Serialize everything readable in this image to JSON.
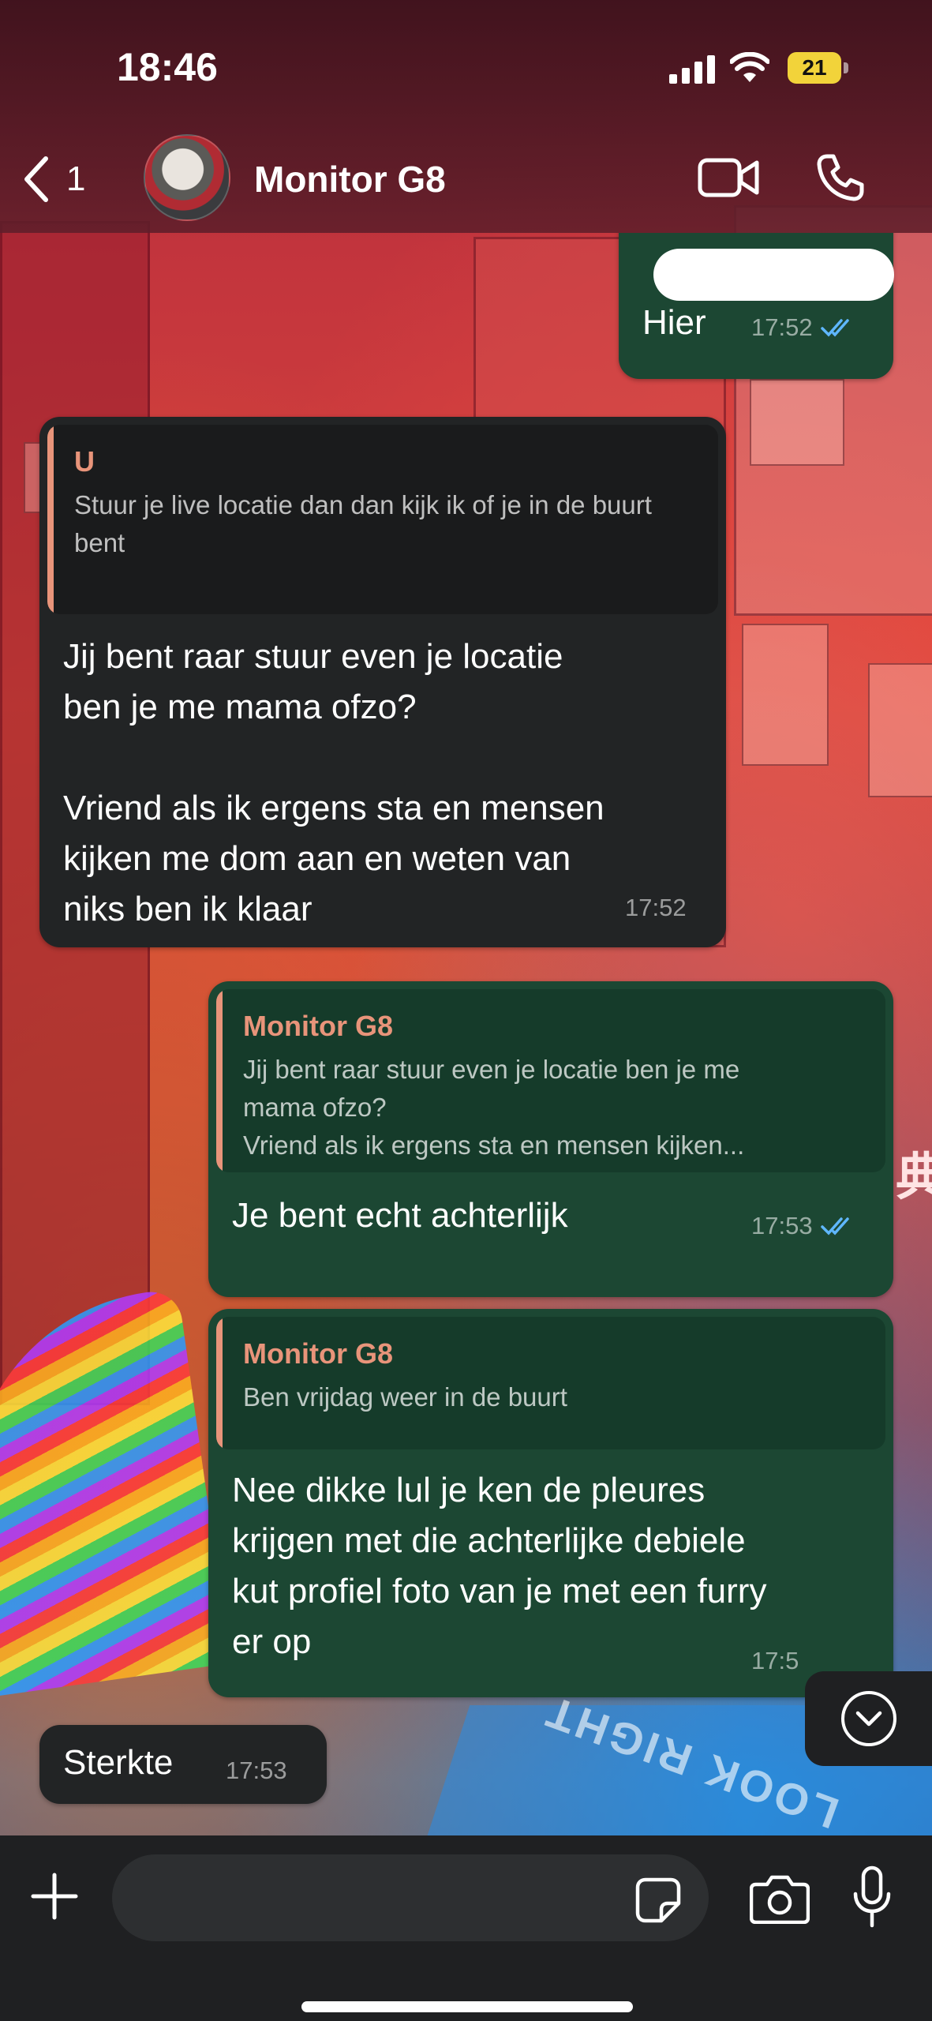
{
  "status_bar": {
    "time": "18:46",
    "battery": "21"
  },
  "header": {
    "back_count": "1",
    "contact_name": "Monitor G8"
  },
  "messages": [
    {
      "id": "m1",
      "direction": "out",
      "text": "Hier",
      "time": "17:52",
      "read": true
    },
    {
      "id": "m2",
      "direction": "in",
      "quote": {
        "author": "U",
        "text": "Stuur je live locatie dan dan kijk ik of je in de buurt bent"
      },
      "text_lines": [
        "Jij bent raar stuur even je locatie",
        "ben je me mama ofzo?",
        "",
        "Vriend als ik ergens sta en mensen",
        "kijken me dom aan en weten van",
        "niks ben ik klaar"
      ],
      "time": "17:52"
    },
    {
      "id": "m3",
      "direction": "out",
      "quote": {
        "author": "Monitor G8",
        "text_lines": [
          "Jij bent raar stuur even je locatie ben je me",
          "mama ofzo?",
          "Vriend als ik ergens sta en mensen kijken..."
        ]
      },
      "text": "Je bent echt achterlijk",
      "time": "17:53",
      "read": true
    },
    {
      "id": "m4",
      "direction": "out",
      "quote": {
        "author": "Monitor G8",
        "text": "Ben vrijdag weer in de buurt"
      },
      "text_lines": [
        "Nee dikke lul je ken de pleures",
        "krijgen met die achterlijke debiele",
        "kut profiel foto van je met een furry",
        "er op"
      ],
      "time_partial": "17:5"
    },
    {
      "id": "m5",
      "direction": "in",
      "text": "Sterkte",
      "time": "17:53"
    }
  ],
  "background": {
    "road_text": "LOOK RIGHT",
    "side_sign": "典"
  },
  "icons": [
    "signal-icon",
    "wifi-icon",
    "chevron-left-icon",
    "video-call-icon",
    "phone-icon",
    "double-check-icon",
    "chevron-down-icon",
    "plus-icon",
    "sticker-icon",
    "camera-icon",
    "microphone-icon"
  ],
  "colors": {
    "incoming_bubble": "#222425",
    "outgoing_bubble": "#1c4733",
    "quote_accent": "#e8947a",
    "read_ticks": "#5fb7ff",
    "battery": "#f2d33a"
  }
}
